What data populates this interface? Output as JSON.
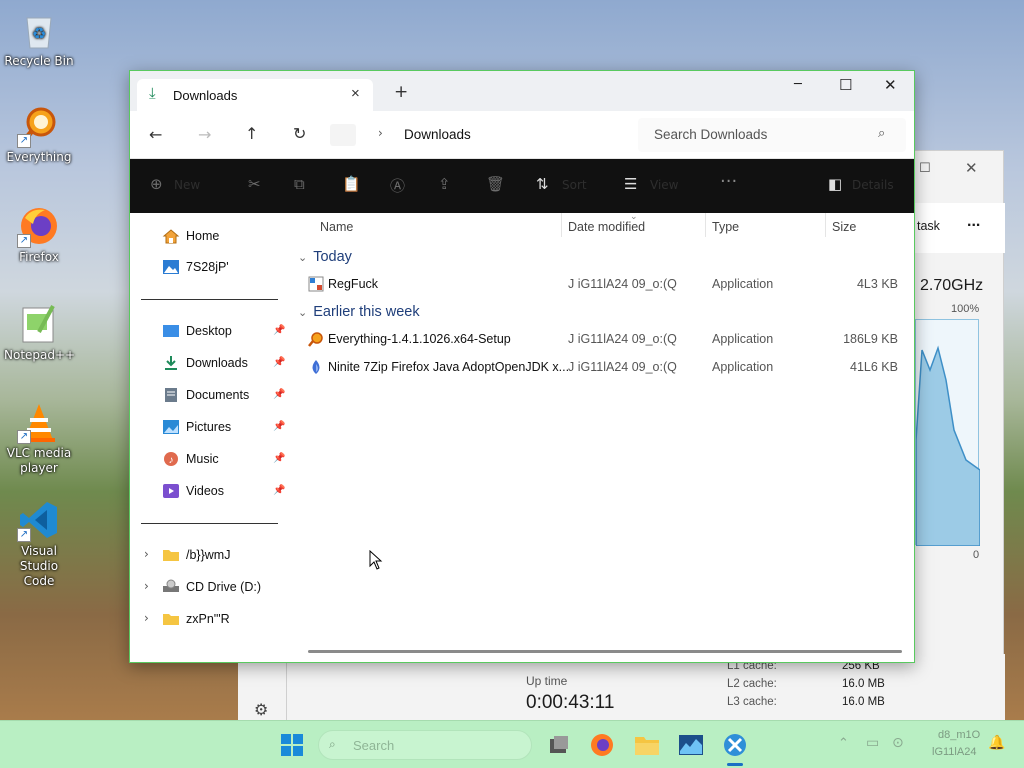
{
  "desktop": {
    "icons": [
      {
        "label": "Recycle Bin",
        "icon": "recycle-bin-icon"
      },
      {
        "label": "Everything",
        "icon": "magnifier-icon"
      },
      {
        "label": "Firefox",
        "icon": "firefox-icon"
      },
      {
        "label": "Notepad++",
        "icon": "notepad-plus-icon"
      },
      {
        "label": "VLC media player",
        "icon": "vlc-icon"
      },
      {
        "label": "Visual Studio Code",
        "icon": "vscode-icon"
      }
    ]
  },
  "taskmgr": {
    "task_label": "task",
    "more": "...",
    "speed": "2.70GHz",
    "pct_top": "100%",
    "pct_bottom": "0",
    "uptime_label": "Up time",
    "uptime_value": "0:00:43:11",
    "cache": [
      {
        "label": "L1 cache:",
        "value": "256 KB"
      },
      {
        "label": "L2 cache:",
        "value": "16.0 MB"
      },
      {
        "label": "L3 cache:",
        "value": "16.0 MB"
      }
    ]
  },
  "explorer": {
    "tab_title": "Downloads",
    "tab_close": "×",
    "new_tab": "+",
    "window_controls": {
      "minimize": "─",
      "maximize": "☐",
      "close": "✕"
    },
    "address": {
      "crumb": "Downloads",
      "search_placeholder": "Search Downloads"
    },
    "toolbar": {
      "new": "New",
      "sort": "Sort",
      "view": "View",
      "more": "···",
      "details": "Details"
    },
    "nav": {
      "top": [
        {
          "label": "Home",
          "icon": "home-icon"
        },
        {
          "label": "7S28jP'",
          "icon": "gallery-icon"
        }
      ],
      "quick": [
        {
          "label": "Desktop",
          "icon": "desktop-icon"
        },
        {
          "label": "Downloads",
          "icon": "download-icon"
        },
        {
          "label": "Documents",
          "icon": "documents-icon"
        },
        {
          "label": "Pictures",
          "icon": "pictures-icon"
        },
        {
          "label": "Music",
          "icon": "music-icon"
        },
        {
          "label": "Videos",
          "icon": "videos-icon"
        }
      ],
      "drives": [
        {
          "label": "/b}}wmJ",
          "icon": "folder-icon"
        },
        {
          "label": "CD Drive (D:)",
          "icon": "cd-drive-icon"
        },
        {
          "label": "zxPn'\"R",
          "icon": "folder-icon"
        }
      ]
    },
    "columns": {
      "name": "Name",
      "date": "Date modified",
      "type": "Type",
      "size": "Size"
    },
    "groups": [
      {
        "label": "Today",
        "files": [
          {
            "name": "RegFuck",
            "date": "J iG11lA24 09_o:(Q",
            "type": "Application",
            "size": "4L3 KB",
            "icon": "regedit-app-icon"
          }
        ]
      },
      {
        "label": "Earlier this week",
        "files": [
          {
            "name": "Everything-1.4.1.1026.x64-Setup",
            "date": "J iG11lA24 09_o:(Q",
            "type": "Application",
            "size": "186L9 KB",
            "icon": "magnifier-icon"
          },
          {
            "name": "Ninite 7Zip Firefox Java AdoptOpenJDK x...",
            "date": "J iG11lA24 09_o:(Q",
            "type": "Application",
            "size": "41L6 KB",
            "icon": "ninite-icon"
          }
        ]
      }
    ]
  },
  "taskbar": {
    "search_placeholder": "Search",
    "clock_time": "d8_m1O",
    "clock_date": "lG11lA24"
  }
}
